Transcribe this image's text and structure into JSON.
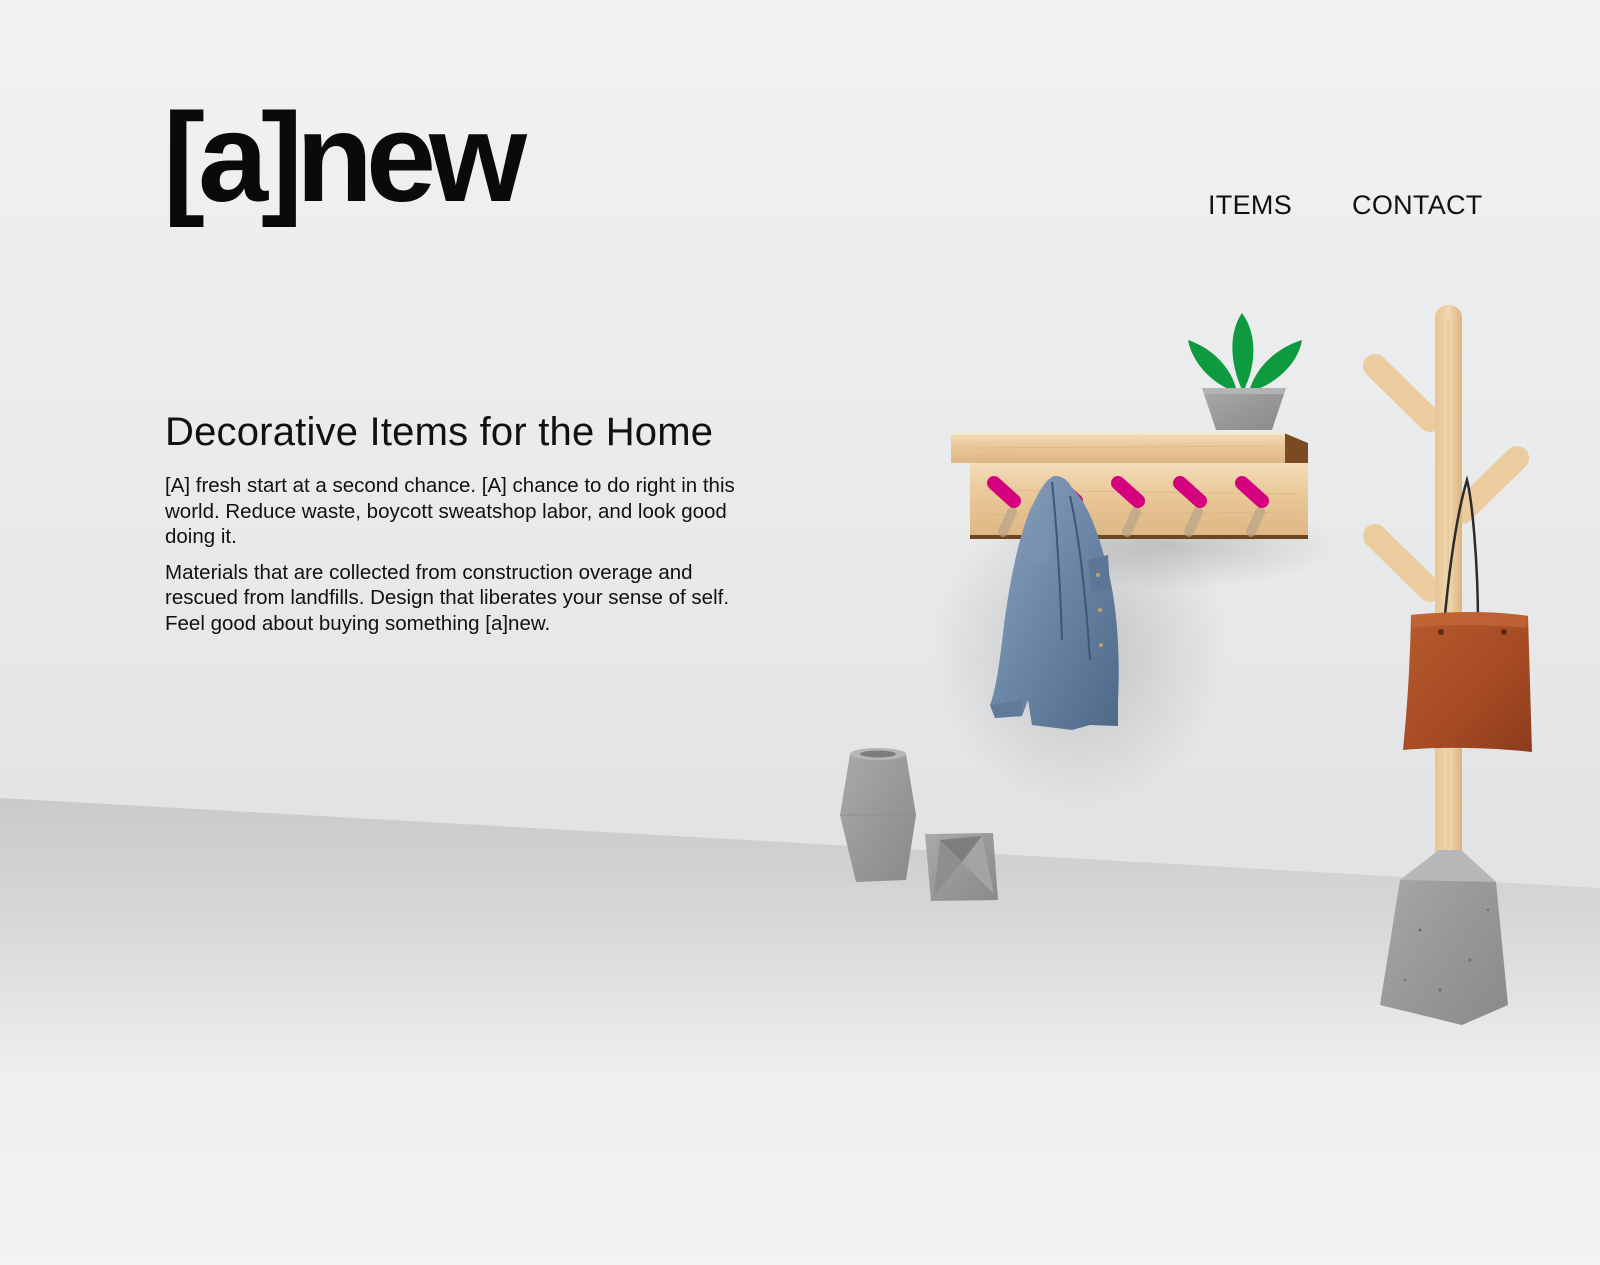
{
  "header": {
    "logo_text": "[a]new",
    "nav": [
      {
        "label": "ITEMS"
      },
      {
        "label": "CONTACT"
      }
    ]
  },
  "hero": {
    "title": "Decorative Items for the Home",
    "paragraphs": [
      "[A] fresh start at a second chance. [A] chance to do right in this world. Reduce waste, boycott sweatshop labor, and look good doing it.",
      "Materials that are collected from construction overage and rescued from landfills. Design that liberates your sense of self. Feel good about buying something [a]new."
    ]
  },
  "illustration": {
    "items": [
      "wall-shelf-with-hooks",
      "potted-plant",
      "denim-jacket",
      "coat-tree",
      "leather-tote-bag",
      "concrete-vase",
      "concrete-planter"
    ],
    "colors": {
      "wood": "#e9c99a",
      "hooks": "#d4007e",
      "plant": "#0e9a3e",
      "concrete": "#9c9d9e",
      "denim": "#6a85a6",
      "leather": "#a54a24"
    }
  }
}
